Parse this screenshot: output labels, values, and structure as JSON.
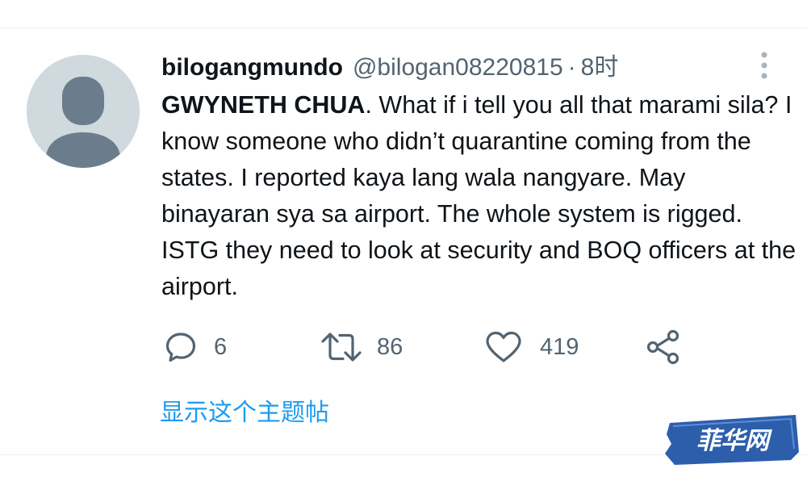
{
  "tweet": {
    "display_name": "bilogangmundo",
    "handle": "@bilogan08220815",
    "separator": "·",
    "time": "8时",
    "mention": "GWYNETH CHUA",
    "text": ". What if i tell you all that marami sila? I know someone who didn’t quarantine coming from the states. I reported kaya lang wala nangyare. May binayaran sya sa airport. The whole system is rigged.  ISTG they need to look at security and BOQ officers at the airport."
  },
  "actions": {
    "reply_count": "6",
    "retweet_count": "86",
    "like_count": "419"
  },
  "thread_link_label": "显示这个主题帖",
  "watermark_text": "菲华网",
  "icons": {
    "avatar": "default-avatar-icon",
    "more": "more-vertical-icon",
    "reply": "reply-icon",
    "retweet": "retweet-icon",
    "like": "heart-icon",
    "share": "share-icon"
  },
  "colors": {
    "link": "#1d9bf0",
    "secondary_text": "#536471",
    "avatar_bg": "#cfd9de",
    "avatar_figure": "#6b7d8c",
    "watermark_bg": "#2c5eab"
  }
}
